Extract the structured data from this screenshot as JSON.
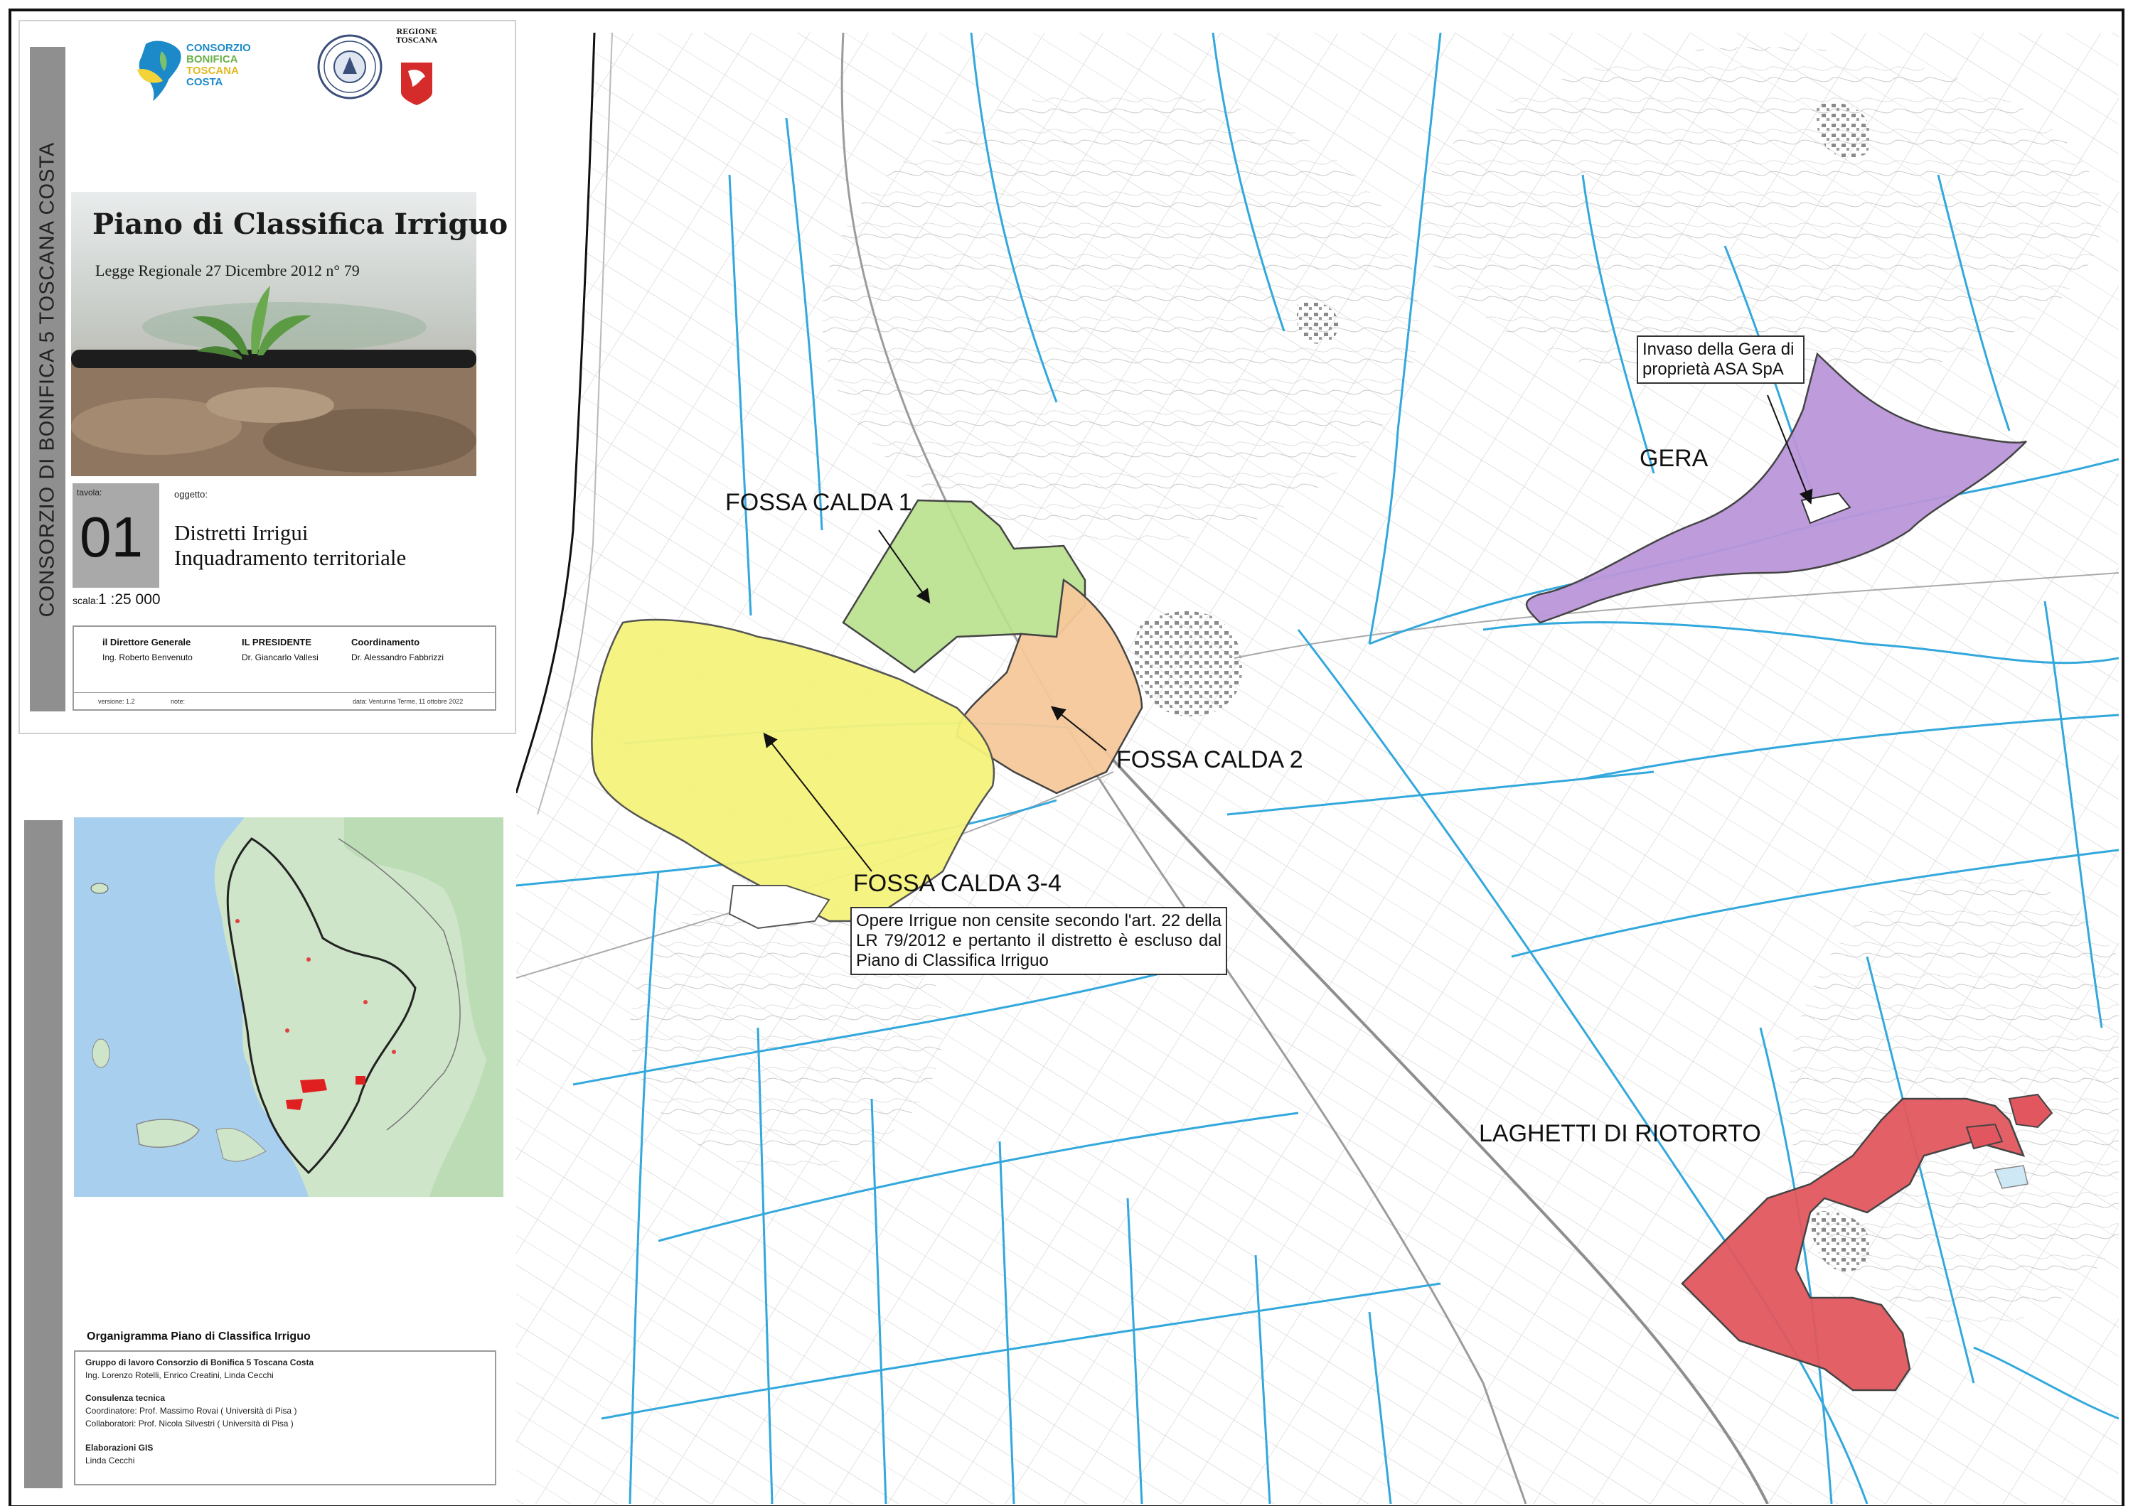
{
  "title_block": {
    "side_text": "CONSORZIO DI BONIFICA 5 TOSCANA COSTA",
    "logo_text": [
      "CONSORZIO",
      "BONIFICA",
      "TOSCANA",
      "COSTA"
    ],
    "regione_text": "REGIONE TOSCANA",
    "cover_title": "Piano di Classifica Irriguo",
    "cover_subtitle": "Legge Regionale 27 Dicembre 2012 n° 79",
    "tavola_label": "tavola:",
    "tavola_number": "01",
    "oggetto_label": "oggetto:",
    "oggetto_line1": "Distretti Irrigui",
    "oggetto_line2": "Inquadramento territoriale",
    "scala_label": "scala:",
    "scala_value": "1 :25 000",
    "signatures": [
      {
        "role": "il Direttore Generale",
        "name": "Ing. Roberto Benvenuto"
      },
      {
        "role": "IL PRESIDENTE",
        "name": "Dr. Giancarlo Vallesi"
      },
      {
        "role": "Coordinamento",
        "name": "Dr. Alessandro Fabbrizzi"
      }
    ],
    "versione": "versione: 1.2",
    "note": "note:",
    "data": "data: Venturina Terme, 11 ottobre 2022"
  },
  "organigramma": {
    "heading": "Organigramma Piano di Classifica Irriguo",
    "lines": [
      {
        "text": "Gruppo di lavoro Consorzio di Bonifica 5 Toscana Costa",
        "bold": true
      },
      {
        "text": "Ing. Lorenzo Rotelli, Enrico Creatini, Linda Cecchi",
        "bold": false
      },
      {
        "text": "Consulenza tecnica",
        "bold": true
      },
      {
        "text": "Coordinatore: Prof. Massimo Rovai ( Università di Pisa )",
        "bold": false
      },
      {
        "text": "Collaboratori: Prof. Nicola Silvestri ( Università di Pisa )",
        "bold": false
      },
      {
        "text": "Elaborazioni GIS",
        "bold": true
      },
      {
        "text": "Linda Cecchi",
        "bold": false
      }
    ]
  },
  "map": {
    "labels": {
      "fossa_calda_1": "FOSSA CALDA 1",
      "fossa_calda_2": "FOSSA CALDA 2",
      "fossa_calda_34": "FOSSA CALDA 3-4",
      "gera": "GERA",
      "laghetti": "LAGHETTI DI RIOTORTO"
    },
    "callout_gera": "Invaso della Gera di proprietà ASA SpA",
    "callout_opere": "Opere Irrigue non censite secondo l'art. 22 della LR 79/2012 e pertanto il distretto è escluso dal Piano di Classifica Irriguo",
    "colors": {
      "fossa_calda_1": "#b8e08c",
      "fossa_calda_2": "#f6c89a",
      "fossa_calda_34": "#f4f27a",
      "gera": "#bb96d9",
      "laghetti": "#e2575f",
      "waterways": "#33a8dc",
      "basemap": "#c8c8c8"
    }
  }
}
